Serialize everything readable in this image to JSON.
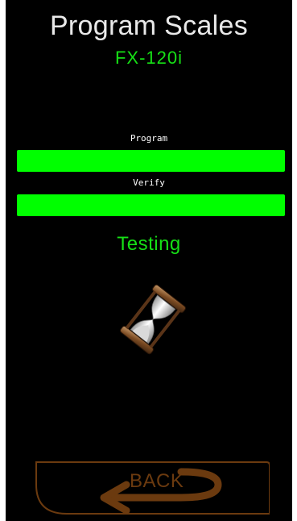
{
  "header": {
    "title": "Program Scales",
    "model": "FX-120i"
  },
  "progress": [
    {
      "label": "Program",
      "fraction": 1.0
    },
    {
      "label": "Verify",
      "fraction": 1.0
    }
  ],
  "status": {
    "text": "Testing",
    "icon": "hourglass-icon"
  },
  "footer": {
    "back_label": "BACK"
  },
  "colors": {
    "background": "#000000",
    "accent_green": "#00ff00",
    "text_green": "#16e016",
    "title_text": "#e9e9e9",
    "back_brown": "#6b3a0f"
  }
}
